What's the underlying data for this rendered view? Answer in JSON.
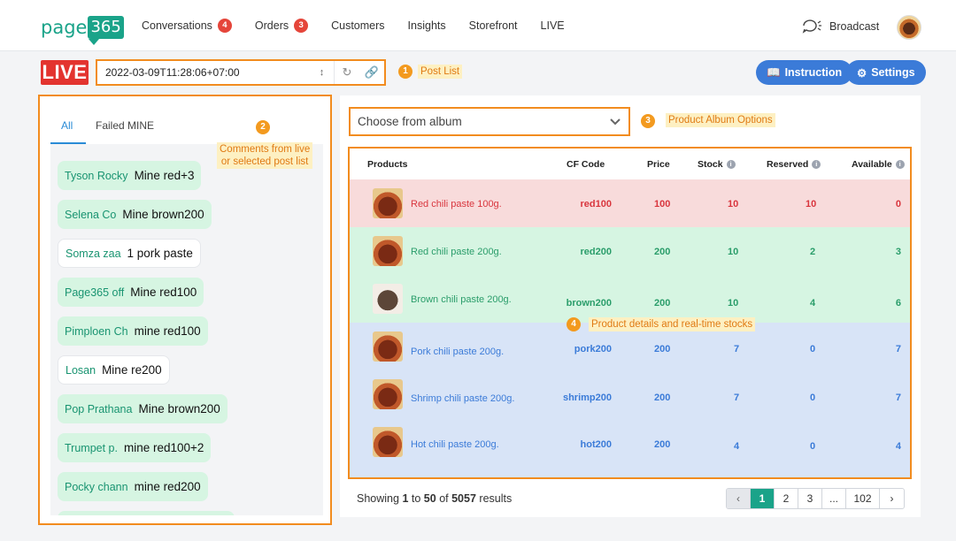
{
  "nav": {
    "logo_text": "page",
    "logo_box": "365",
    "items": [
      {
        "label": "Conversations",
        "badge": "4"
      },
      {
        "label": "Orders",
        "badge": "3"
      },
      {
        "label": "Customers"
      },
      {
        "label": "Insights"
      },
      {
        "label": "Storefront"
      },
      {
        "label": "LIVE"
      }
    ],
    "broadcast": "Broadcast"
  },
  "toolbar": {
    "live_badge": "LIVE",
    "post_value": "2022-03-09T11:28:06+07:00",
    "instruction": "Instruction",
    "settings": "Settings"
  },
  "annotations": {
    "a1_num": "1",
    "a1_text": "Post List",
    "a2_num": "2",
    "a2_text_l1": "Comments from live",
    "a2_text_l2": "or selected post list",
    "a3_num": "3",
    "a3_text": "Product Album Options",
    "a4_num": "4",
    "a4_text": "Product details and real-time stocks"
  },
  "comments_panel": {
    "tabs": [
      "All",
      "Failed MINE"
    ],
    "comments": [
      {
        "author": "Tyson Rocky",
        "text": "Mine red+3",
        "style": "green"
      },
      {
        "author": "Selena Co",
        "text": "Mine brown200",
        "style": "green"
      },
      {
        "author": "Somza zaa",
        "text": "1 pork paste",
        "style": "white"
      },
      {
        "author": "Page365 off",
        "text": "Mine red100",
        "style": "green"
      },
      {
        "author": "Pimploen Ch",
        "text": "mine red100",
        "style": "green"
      },
      {
        "author": "Losan",
        "text": "Mine re200",
        "style": "white"
      },
      {
        "author": "Pop Prathana",
        "text": "Mine brown200",
        "style": "green"
      },
      {
        "author": "Trumpet p.",
        "text": "mine red100+2",
        "style": "green"
      },
      {
        "author": "Pocky chann",
        "text": "mine red200",
        "style": "green"
      }
    ]
  },
  "album": {
    "placeholder": "Choose from album"
  },
  "table": {
    "headers": {
      "products": "Products",
      "cf_code": "CF Code",
      "price": "Price",
      "stock": "Stock",
      "reserved": "Reserved",
      "available": "Available"
    },
    "rows": [
      {
        "name": "Red chili paste 100g.",
        "cf": "red100",
        "price": "100",
        "stock": "10",
        "reserved": "10",
        "available": "0",
        "status": "sold-out"
      },
      {
        "name": "Red chili paste 200g.",
        "cf": "red200",
        "price": "200",
        "stock": "10",
        "reserved": "2",
        "available": "3",
        "status": "reserved"
      },
      {
        "name": "Brown chili paste 200g.",
        "cf": "brown200",
        "price": "200",
        "stock": "10",
        "reserved": "4",
        "available": "6",
        "status": "reserved"
      },
      {
        "name": "Pork chili paste 200g.",
        "cf": "pork200",
        "price": "200",
        "stock": "7",
        "reserved": "0",
        "available": "7",
        "status": "available"
      },
      {
        "name": "Shrimp chili paste 200g.",
        "cf": "shrimp200",
        "price": "200",
        "stock": "7",
        "reserved": "0",
        "available": "7",
        "status": "available"
      },
      {
        "name": "Hot chili paste 200g.",
        "cf": "hot200",
        "price": "200",
        "stock": "4",
        "reserved": "0",
        "available": "4",
        "status": "available"
      }
    ],
    "colors": {
      "sold-out": {
        "bg": "#f8dbdb",
        "fg": "#d9363e"
      },
      "reserved": {
        "bg": "#d6f5e2",
        "fg": "#2a9d6a"
      },
      "available": {
        "bg": "#d8e4f7",
        "fg": "#3b7bd8"
      }
    }
  },
  "pagination": {
    "showing_prefix": "Showing",
    "from": "1",
    "to_word": "to",
    "to": "50",
    "of_word": "of",
    "total": "5057",
    "suffix": "results",
    "pages": [
      "1",
      "2",
      "3",
      "...",
      "102"
    ],
    "active": "1"
  }
}
